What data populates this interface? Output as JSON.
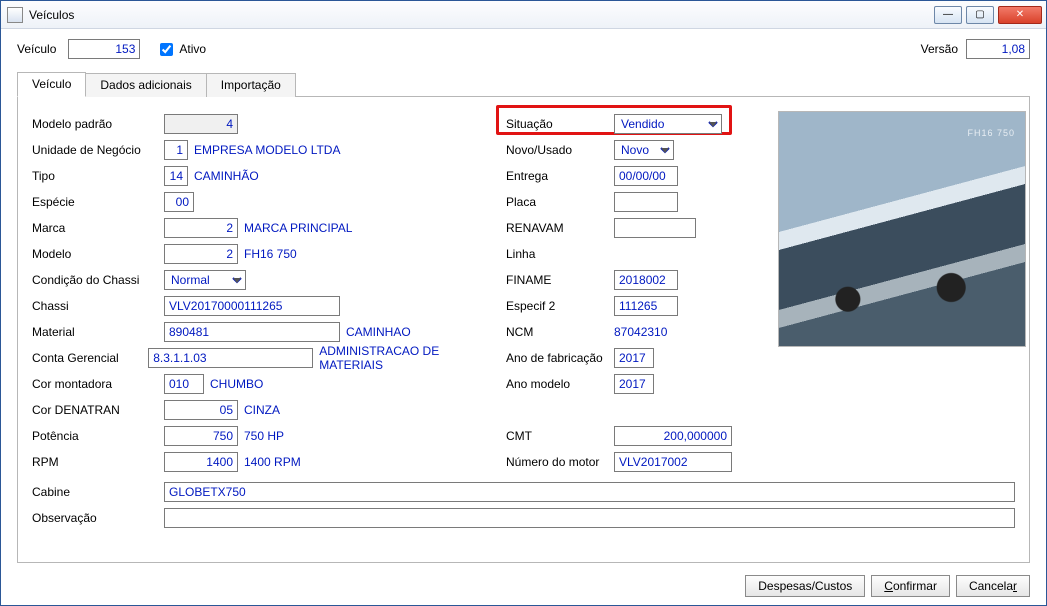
{
  "window": {
    "title": "Veículos"
  },
  "header": {
    "veiculo_label": "Veículo",
    "veiculo_value": "153",
    "ativo_label": "Ativo",
    "ativo_checked": true,
    "versao_label": "Versão",
    "versao_value": "1,08"
  },
  "tabs": {
    "veiculo": "Veículo",
    "dados_adicionais": "Dados adicionais",
    "importacao": "Importação"
  },
  "left": {
    "modelo_padrao": {
      "label": "Modelo padrão",
      "value": "4"
    },
    "unidade_negocio": {
      "label": "Unidade de Negócio",
      "id": "1",
      "desc": "EMPRESA MODELO LTDA"
    },
    "tipo": {
      "label": "Tipo",
      "id": "14",
      "desc": "CAMINHÃO"
    },
    "especie": {
      "label": "Espécie",
      "id": "00"
    },
    "marca": {
      "label": "Marca",
      "id": "2",
      "desc": "MARCA PRINCIPAL"
    },
    "modelo": {
      "label": "Modelo",
      "id": "2",
      "desc": "FH16 750"
    },
    "cond_chassi": {
      "label": "Condição do Chassi",
      "value": "Normal"
    },
    "chassi": {
      "label": "Chassi",
      "value": "VLV20170000111265"
    },
    "material": {
      "label": "Material",
      "id": "890481",
      "desc": "CAMINHAO"
    },
    "conta_ger": {
      "label": "Conta Gerencial",
      "id": "8.3.1.1.03",
      "desc": "ADMINISTRACAO DE MATERIAIS"
    },
    "cor_montadora": {
      "label": "Cor montadora",
      "id": "010",
      "desc": "CHUMBO"
    },
    "cor_denatran": {
      "label": "Cor DENATRAN",
      "id": "05",
      "desc": "CINZA"
    },
    "potencia": {
      "label": "Potência",
      "id": "750",
      "desc": "750 HP"
    },
    "rpm": {
      "label": "RPM",
      "id": "1400",
      "desc": "1400 RPM"
    },
    "cabine": {
      "label": "Cabine",
      "value": "GLOBETX750"
    },
    "observacao": {
      "label": "Observação",
      "value": ""
    }
  },
  "right": {
    "situacao": {
      "label": "Situação",
      "value": "Vendido"
    },
    "novo_usado": {
      "label": "Novo/Usado",
      "value": "Novo"
    },
    "entrega": {
      "label": "Entrega",
      "value": "00/00/00"
    },
    "placa": {
      "label": "Placa",
      "value": ""
    },
    "renavam": {
      "label": "RENAVAM",
      "value": ""
    },
    "linha": {
      "label": "Linha",
      "value": ""
    },
    "finame": {
      "label": "FINAME",
      "value": "2018002"
    },
    "especif2": {
      "label": "Especif 2",
      "value": "111265"
    },
    "ncm": {
      "label": "NCM",
      "value": "87042310"
    },
    "ano_fab": {
      "label": "Ano de fabricação",
      "value": "2017"
    },
    "ano_modelo": {
      "label": "Ano modelo",
      "value": "2017"
    },
    "cmt": {
      "label": "CMT",
      "value": "200,000000"
    },
    "num_motor": {
      "label": "Número do motor",
      "value": "VLV2017002"
    }
  },
  "footer": {
    "despesas": "Despesas/Custos",
    "confirmar": "Confirmar",
    "cancelar": "Cancelar"
  }
}
